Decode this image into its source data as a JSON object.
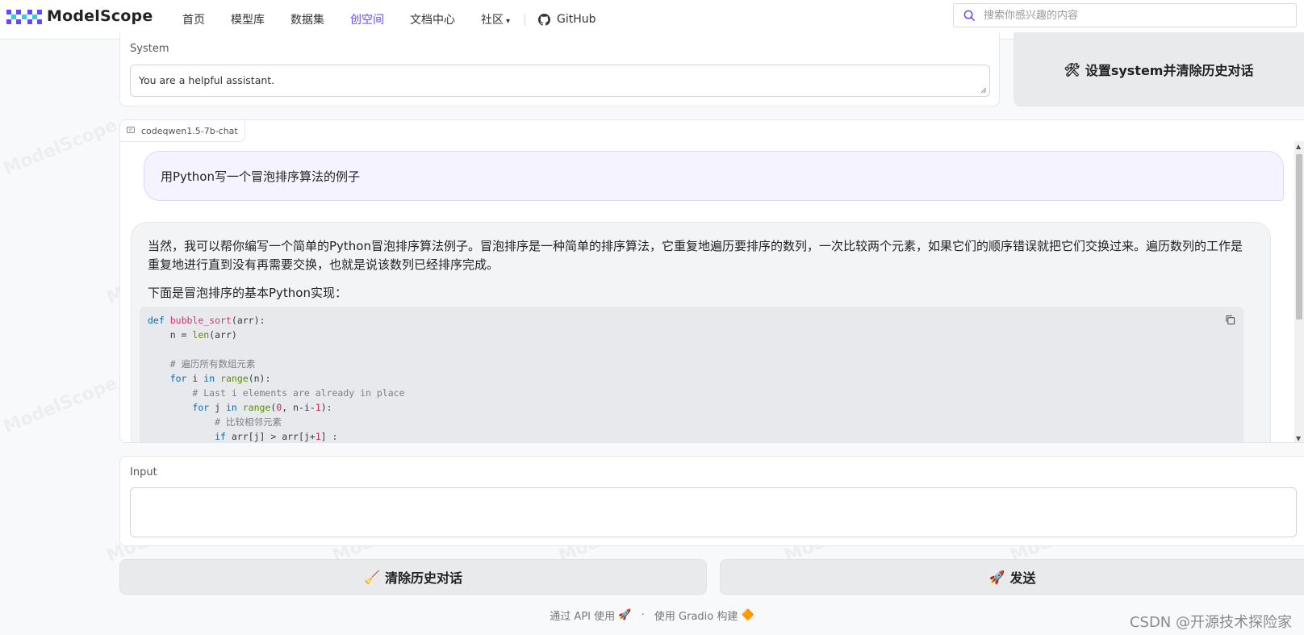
{
  "brand": {
    "name": "ModelScope"
  },
  "nav": {
    "items": [
      {
        "label": "首页"
      },
      {
        "label": "模型库"
      },
      {
        "label": "数据集"
      },
      {
        "label": "创空间",
        "active": true
      },
      {
        "label": "文档中心"
      },
      {
        "label": "社区",
        "caret": "▾"
      }
    ],
    "github_label": "GitHub"
  },
  "search": {
    "placeholder": "搜索你感兴趣的内容"
  },
  "system": {
    "label": "System",
    "value": "You are a helpful assistant.",
    "button_icon": "🛠",
    "button_label": "设置system并清除历史对话"
  },
  "chat": {
    "model_name": "codeqwen1.5-7b-chat",
    "user_message": "用Python写一个冒泡排序算法的例子",
    "bot_paragraph_1": "当然，我可以帮你编写一个简单的Python冒泡排序算法例子。冒泡排序是一种简单的排序算法，它重复地遍历要排序的数列，一次比较两个元素，如果它们的顺序错误就把它们交换过来。遍历数列的工作是重复地进行直到没有再需要交换，也就是说该数列已经排序完成。",
    "bot_paragraph_2": "下面是冒泡排序的基本Python实现：",
    "code_lines": [
      "def bubble_sort(arr):",
      "    n = len(arr)",
      "",
      "    # 遍历所有数组元素",
      "    for i in range(n):",
      "        # Last i elements are already in place",
      "        for j in range(0, n-i-1):",
      "            # 比较相邻元素",
      "            if arr[j] > arr[j+1] :"
    ]
  },
  "input": {
    "label": "Input",
    "value": ""
  },
  "actions": {
    "clear_icon": "🧹",
    "clear_label": "清除历史对话",
    "send_icon": "🚀",
    "send_label": "发送"
  },
  "footer": {
    "api_label": "通过 API 使用",
    "api_icon": "🚀",
    "dot": "·",
    "gradio_label": "使用 Gradio 构建",
    "gradio_icon": "🔶"
  },
  "watermark": {
    "text": "ModelScope",
    "author": "CSDN @开源技术探险家"
  },
  "colors": {
    "accent": "#624aff",
    "user_bubble": "#f5f3ff",
    "bot_bubble": "#f3f4f6",
    "button_bg": "#e9eaec"
  }
}
